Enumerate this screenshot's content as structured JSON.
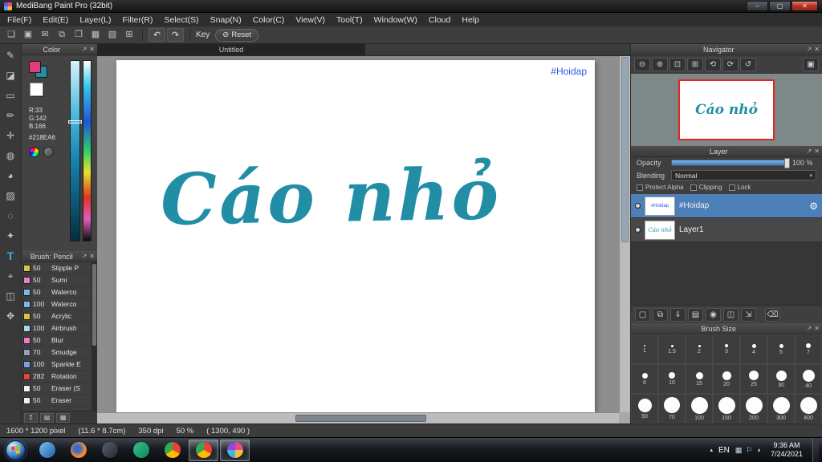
{
  "window": {
    "title": "MediBang Paint Pro (32bit)",
    "controls": {
      "minimize": "–",
      "maximize": "▢",
      "close": "✕"
    }
  },
  "icons": {
    "popout": "↗",
    "close": "✕",
    "caret": "▾",
    "gear": "⚙",
    "tray_arrow": "▴"
  },
  "menubar": {
    "items": [
      {
        "id": "file-menu",
        "label": "File(F)"
      },
      {
        "id": "edit-menu",
        "label": "Edit(E)"
      },
      {
        "id": "layer-menu",
        "label": "Layer(L)"
      },
      {
        "id": "filter-menu",
        "label": "Filter(R)"
      },
      {
        "id": "select-menu",
        "label": "Select(S)"
      },
      {
        "id": "snap-menu",
        "label": "Snap(N)"
      },
      {
        "id": "color-menu",
        "label": "Color(C)"
      },
      {
        "id": "view-menu",
        "label": "View(V)"
      },
      {
        "id": "tool-menu",
        "label": "Tool(T)"
      },
      {
        "id": "window-menu",
        "label": "Window(W)"
      },
      {
        "id": "cloud-menu",
        "label": "Cloud"
      },
      {
        "id": "help-menu",
        "label": "Help"
      }
    ]
  },
  "toolbar": {
    "buttons": [
      {
        "id": "new-canvas-icon",
        "glyph": "❏"
      },
      {
        "id": "save-icon",
        "glyph": "▣"
      },
      {
        "id": "comment-icon",
        "glyph": "✉"
      },
      {
        "id": "copy-icon",
        "glyph": "⧉"
      },
      {
        "id": "paste-icon",
        "glyph": "❐"
      },
      {
        "id": "grid-icon",
        "glyph": "▦"
      },
      {
        "id": "snap-grid-icon",
        "glyph": "▧"
      },
      {
        "id": "material-icon",
        "glyph": "⊞"
      }
    ],
    "undo_glyph": "↶",
    "redo_glyph": "↷",
    "key_label": "Key",
    "reset_icon": "⊘",
    "reset_label": "Reset"
  },
  "tools": {
    "items": [
      {
        "id": "pen-tool",
        "glyph": "✎",
        "selected": false
      },
      {
        "id": "eraser-tool",
        "glyph": "◪",
        "selected": false
      },
      {
        "id": "select-rect-tool",
        "glyph": "▭",
        "selected": false
      },
      {
        "id": "brush-tool",
        "glyph": "✏",
        "selected": false
      },
      {
        "id": "move-tool",
        "glyph": "✛",
        "selected": false
      },
      {
        "id": "fill-tool",
        "glyph": "◍",
        "selected": false
      },
      {
        "id": "bucket-tool",
        "glyph": "◕",
        "selected": false
      },
      {
        "id": "gradient-tool",
        "glyph": "▨",
        "selected": false
      },
      {
        "id": "lasso-tool",
        "glyph": "◌",
        "selected": false
      },
      {
        "id": "magic-wand-tool",
        "glyph": "✦",
        "selected": false
      },
      {
        "id": "text-tool",
        "glyph": "T",
        "selected": true
      },
      {
        "id": "eyedropper-tool",
        "glyph": "⌖",
        "selected": false
      },
      {
        "id": "divide-tool",
        "glyph": "◫",
        "selected": false
      },
      {
        "id": "hand-tool",
        "glyph": "✥",
        "selected": false
      }
    ]
  },
  "color_panel": {
    "title": "Color",
    "r": "R:33",
    "g": "G:142",
    "b": "B:166",
    "hex": "#218EA6",
    "foreground": "#E23B7D",
    "background_color": "#218EA6"
  },
  "brush_panel": {
    "title": "Brush: Pencil",
    "brushes": [
      {
        "id": "brush-stipple",
        "size": "50",
        "name": "Stipple P",
        "color": "#d8c244"
      },
      {
        "id": "brush-sumi",
        "size": "50",
        "name": "Sumi",
        "color": "#e87fc8"
      },
      {
        "id": "brush-watercolor-1",
        "size": "50",
        "name": "Waterco",
        "color": "#7fb4e8"
      },
      {
        "id": "brush-watercolor-2",
        "size": "100",
        "name": "Waterco",
        "color": "#7fb4e8"
      },
      {
        "id": "brush-acrylic",
        "size": "50",
        "name": "Acrylic",
        "color": "#d8c244"
      },
      {
        "id": "brush-airbrush",
        "size": "100",
        "name": "Airbrush",
        "color": "#a6d8e8"
      },
      {
        "id": "brush-blur",
        "size": "50",
        "name": "Blur",
        "color": "#e87fc8"
      },
      {
        "id": "brush-smudge",
        "size": "70",
        "name": "Smudge",
        "color": "#94a0b8"
      },
      {
        "id": "brush-sparkle",
        "size": "100",
        "name": "Sparkle E",
        "color": "#7f9ce8"
      },
      {
        "id": "brush-rotation",
        "size": "282",
        "name": "Rotation",
        "color": "#e04838"
      },
      {
        "id": "brush-eraser-soft",
        "size": "50",
        "name": "Eraser (S",
        "color": "#f2f2f2"
      },
      {
        "id": "brush-eraser",
        "size": "50",
        "name": "Eraser",
        "color": "#f2f2f2"
      }
    ],
    "footer_buttons": [
      {
        "id": "add-brush-icon",
        "glyph": "↥"
      },
      {
        "id": "brush-folder-icon",
        "glyph": "▤"
      },
      {
        "id": "brush-view-icon",
        "glyph": "▦"
      }
    ]
  },
  "canvas": {
    "tab": "Untitled",
    "hashtag": "#Hoidap",
    "artwork": "Cáo nhỏ"
  },
  "navigator": {
    "title": "Navigator",
    "buttons": [
      {
        "id": "zoom-out-icon",
        "glyph": "⊖"
      },
      {
        "id": "zoom-in-icon",
        "glyph": "⊕"
      },
      {
        "id": "zoom-fit-icon",
        "glyph": "⊡"
      },
      {
        "id": "zoom-actual-icon",
        "glyph": "⊞"
      },
      {
        "id": "rotate-left-icon",
        "glyph": "⟲"
      },
      {
        "id": "rotate-right-icon",
        "glyph": "⟳"
      },
      {
        "id": "rotate-reset-icon",
        "glyph": "↺"
      },
      {
        "id": "fullscreen-icon",
        "glyph": "▣"
      }
    ]
  },
  "layer_panel": {
    "title": "Layer",
    "opacity_label": "Opacity",
    "opacity_value": "100 %",
    "blending_label": "Blending",
    "blending_value": "Normal",
    "checkboxes": [
      {
        "id": "protect-alpha-checkbox",
        "label": "Protect Alpha"
      },
      {
        "id": "clipping-checkbox",
        "label": "Clipping"
      },
      {
        "id": "lock-checkbox",
        "label": "Lock"
      }
    ],
    "layers": [
      {
        "id": "layer-hoidap",
        "name": "#Hoidap",
        "thumb_text": "#Hoidap",
        "thumb_color": "#2f55e8",
        "selected": true,
        "gear": true
      },
      {
        "id": "layer-1",
        "name": "Layer1",
        "thumb_text": "Cáo nhỏ",
        "thumb_color": "#218EA6",
        "selected": false,
        "gear": false
      }
    ],
    "actions": [
      {
        "id": "add-layer-icon",
        "glyph": "▢"
      },
      {
        "id": "duplicate-layer-icon",
        "glyph": "⧉"
      },
      {
        "id": "merge-down-icon",
        "glyph": "⇓"
      },
      {
        "id": "add-folder-icon",
        "glyph": "▤"
      },
      {
        "id": "layer-camera-icon",
        "glyph": "◉"
      },
      {
        "id": "combine-layer-icon",
        "glyph": "◫"
      },
      {
        "id": "flatten-icon",
        "glyph": "⇲"
      },
      {
        "id": "delete-layer-icon",
        "glyph": "⌫"
      }
    ]
  },
  "brush_size": {
    "title": "Brush Size",
    "items": [
      {
        "label": "1",
        "value": 1
      },
      {
        "label": "1.5",
        "value": 1.5
      },
      {
        "label": "2",
        "value": 2
      },
      {
        "label": "3",
        "value": 3
      },
      {
        "label": "4",
        "value": 4
      },
      {
        "label": "5",
        "value": 5
      },
      {
        "label": "7",
        "value": 7
      },
      {
        "label": "8",
        "value": 8
      },
      {
        "label": "10",
        "value": 10
      },
      {
        "label": "15",
        "value": 15
      },
      {
        "label": "20",
        "value": 20
      },
      {
        "label": "25",
        "value": 25
      },
      {
        "label": "30",
        "value": 30
      },
      {
        "label": "40",
        "value": 40
      },
      {
        "label": "50",
        "value": 50
      },
      {
        "label": "70",
        "value": 70
      },
      {
        "label": "100",
        "value": 100
      },
      {
        "label": "150",
        "value": 150
      },
      {
        "label": "200",
        "value": 200
      },
      {
        "label": "300",
        "value": 300
      },
      {
        "label": "400",
        "value": 400
      }
    ]
  },
  "statusbar": {
    "size": "1600 * 1200 pixel",
    "physical": "(11.6 * 8.7cm)",
    "dpi": "350 dpi",
    "zoom": "50 %",
    "cursor": "( 1300, 490 )"
  },
  "taskbar": {
    "items": [
      {
        "id": "taskbar-media-icon",
        "bg": "linear-gradient(135deg,#7cc0f0,#1e5fa8)",
        "active": false
      },
      {
        "id": "taskbar-firefox-icon",
        "bg": "radial-gradient(circle at 42% 42%,#3a6cc8 26%,#f1902f 58%,#e25a12)",
        "active": false
      },
      {
        "id": "taskbar-app-icon",
        "bg": "linear-gradient(135deg,#5a6170,#23262e)",
        "active": false
      },
      {
        "id": "taskbar-messenger-icon",
        "bg": "linear-gradient(135deg,#35c08a,#0e8a5c)",
        "active": false
      },
      {
        "id": "taskbar-chrome-icon",
        "bg": "conic-gradient(#ea4335 0 33%,#fbbc05 0 66%,#34a853 0 100%)",
        "active": false
      },
      {
        "id": "taskbar-chrome-active-icon",
        "bg": "conic-gradient(#ea4335 0 33%,#fbbc05 0 66%,#34a853 0 100%)",
        "active": true
      },
      {
        "id": "taskbar-medibang-icon",
        "bg": "conic-gradient(#e84a8a 0 25%,#f0c040 0 50%,#4ab0e0 0 75%,#8a4ae0 0 100%)",
        "active": true
      }
    ],
    "lang": "EN",
    "tray_icons": [
      {
        "id": "tray-app-icon",
        "glyph": "▦"
      },
      {
        "id": "tray-network-icon",
        "glyph": "⚐"
      },
      {
        "id": "tray-volume-icon",
        "glyph": "◖"
      }
    ],
    "time": "9:36 AM",
    "date": "7/24/2021"
  },
  "colors": {
    "accent": "#218EA6",
    "selected_layer": "#4D80B8",
    "hashtag_blue": "#2F55E8"
  }
}
